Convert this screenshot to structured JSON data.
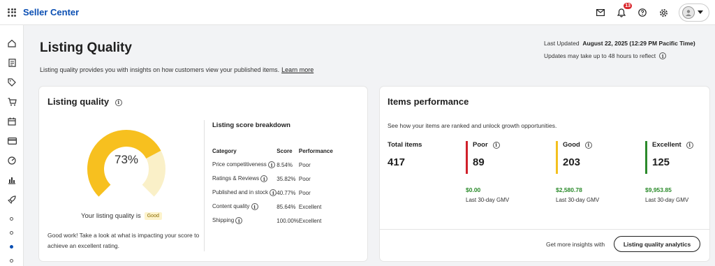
{
  "header": {
    "brand": "Seller Center",
    "notification_count": "13",
    "icons": [
      "mail-icon",
      "bell-icon",
      "help-icon",
      "gear-icon",
      "avatar-icon",
      "caret-down-icon"
    ]
  },
  "sidebar": {
    "icons": [
      "home-icon",
      "document-icon",
      "tag-icon",
      "cart-icon",
      "calendar-icon",
      "card-icon",
      "gauge-icon",
      "bar-chart-icon",
      "rocket-icon"
    ]
  },
  "page": {
    "title": "Listing Quality",
    "description": "Listing quality provides you with insights on how customers view your published items.",
    "learn_more": "Learn more",
    "last_updated_label": "Last Updated",
    "last_updated_value": "August 22, 2025 (12:29 PM Pacific Time)",
    "update_note": "Updates may take up to 48 hours to reflect"
  },
  "listing_quality": {
    "title": "Listing quality",
    "score_percent": 73,
    "score_text": "73%",
    "status_prefix": "Your listing quality is",
    "status": "Good",
    "message": "Good work! Take a look at what is impacting your score to achieve an excellent rating.",
    "accent_color": "#f7c01f",
    "track_color": "#faf0c8",
    "breakdown": {
      "title": "Listing score breakdown",
      "headers": [
        "Category",
        "Score",
        "Performance"
      ],
      "rows": [
        {
          "category": "Price competitiveness",
          "score": "8.54%",
          "performance": "Poor"
        },
        {
          "category": "Ratings & Reviews",
          "score": "35.82%",
          "performance": "Poor"
        },
        {
          "category": "Published and in stock",
          "score": "40.77%",
          "performance": "Poor"
        },
        {
          "category": "Content quality",
          "score": "85.64%",
          "performance": "Excellent"
        },
        {
          "category": "Shipping",
          "score": "100.00%",
          "performance": "Excellent"
        }
      ]
    }
  },
  "items_performance": {
    "title": "Items performance",
    "description": "See how your items are ranked and unlock growth opportunities.",
    "total": {
      "label": "Total items",
      "value": "417"
    },
    "poor": {
      "label": "Poor",
      "value": "89",
      "gmv": "$0.00",
      "gmv_label": "Last 30-day GMV",
      "color": "#d0202a"
    },
    "good": {
      "label": "Good",
      "value": "203",
      "gmv": "$2,580.78",
      "gmv_label": "Last 30-day GMV",
      "color": "#f4c01e"
    },
    "excellent": {
      "label": "Excellent",
      "value": "125",
      "gmv": "$9,953.85",
      "gmv_label": "Last 30-day GMV",
      "color": "#2b8a2b"
    },
    "footer_text": "Get more insights with",
    "cta": "Listing quality analytics"
  }
}
